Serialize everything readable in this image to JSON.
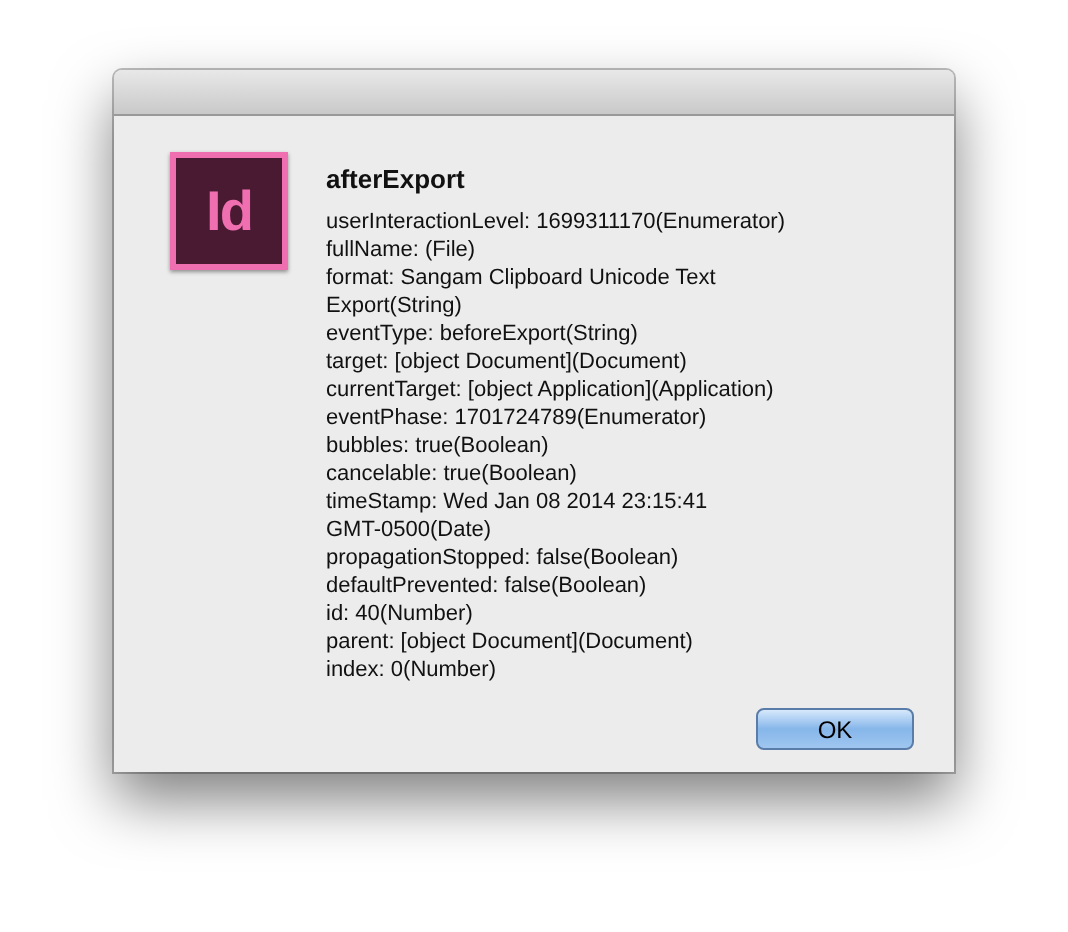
{
  "app_icon": {
    "label": "Id"
  },
  "dialog": {
    "title": "afterExport",
    "lines": [
      "userInteractionLevel: 1699311170(Enumerator)",
      "fullName: (File)",
      "format: Sangam Clipboard Unicode Text",
      "Export(String)",
      "eventType: beforeExport(String)",
      "target: [object Document](Document)",
      "currentTarget: [object Application](Application)",
      "eventPhase: 1701724789(Enumerator)",
      "bubbles: true(Boolean)",
      "cancelable: true(Boolean)",
      "timeStamp: Wed Jan 08 2014 23:15:41",
      "GMT-0500(Date)",
      "propagationStopped: false(Boolean)",
      "defaultPrevented: false(Boolean)",
      "id: 40(Number)",
      "parent: [object Document](Document)",
      "index: 0(Number)"
    ],
    "buttons": [
      "OK"
    ]
  }
}
